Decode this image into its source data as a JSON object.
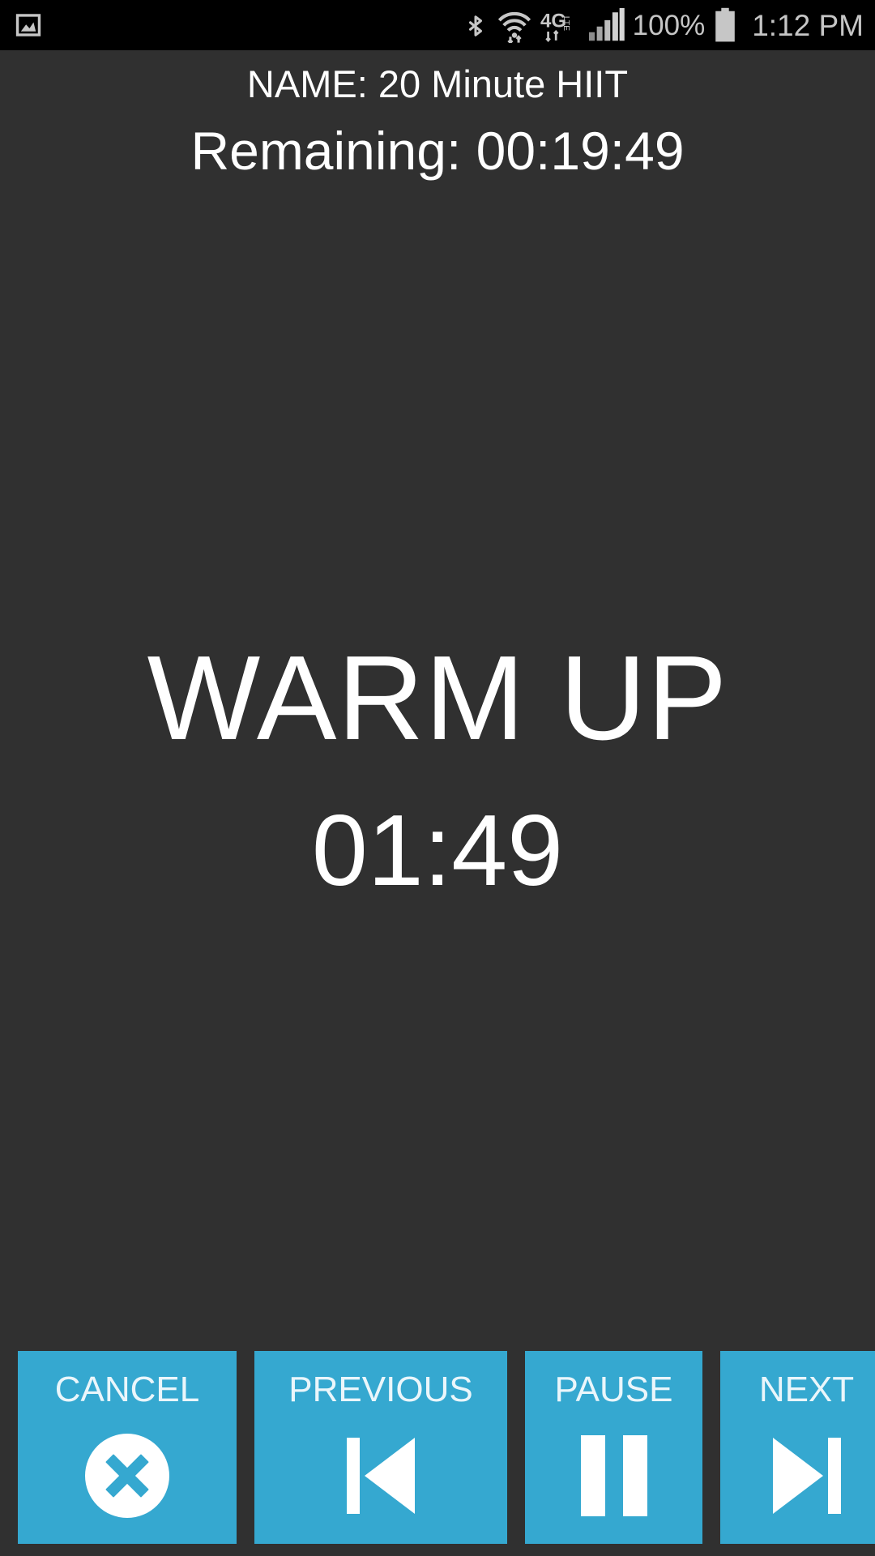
{
  "status_bar": {
    "background": "#000000",
    "foreground": "#c6c6c6",
    "notification_icon": "gallery-image-icon",
    "icons": [
      "bluetooth-icon",
      "wifi-icon",
      "4g-lte-icon",
      "cellular-signal-icon"
    ],
    "battery_percent": "100%",
    "clock": "1:12 PM"
  },
  "header": {
    "workout_name": "NAME: 20 Minute HIIT",
    "remaining": "Remaining: 00:19:49"
  },
  "main": {
    "interval_name": "WARM UP",
    "interval_timer": "01:49"
  },
  "controls": {
    "accent_color": "#35A8D0",
    "background_color": "#303030",
    "buttons": [
      {
        "label": "CANCEL",
        "icon": "cancel-circle-x-icon"
      },
      {
        "label": "PREVIOUS",
        "icon": "skip-previous-icon"
      },
      {
        "label": "PAUSE",
        "icon": "pause-icon"
      },
      {
        "label": "NEXT",
        "icon": "skip-next-icon"
      }
    ]
  }
}
